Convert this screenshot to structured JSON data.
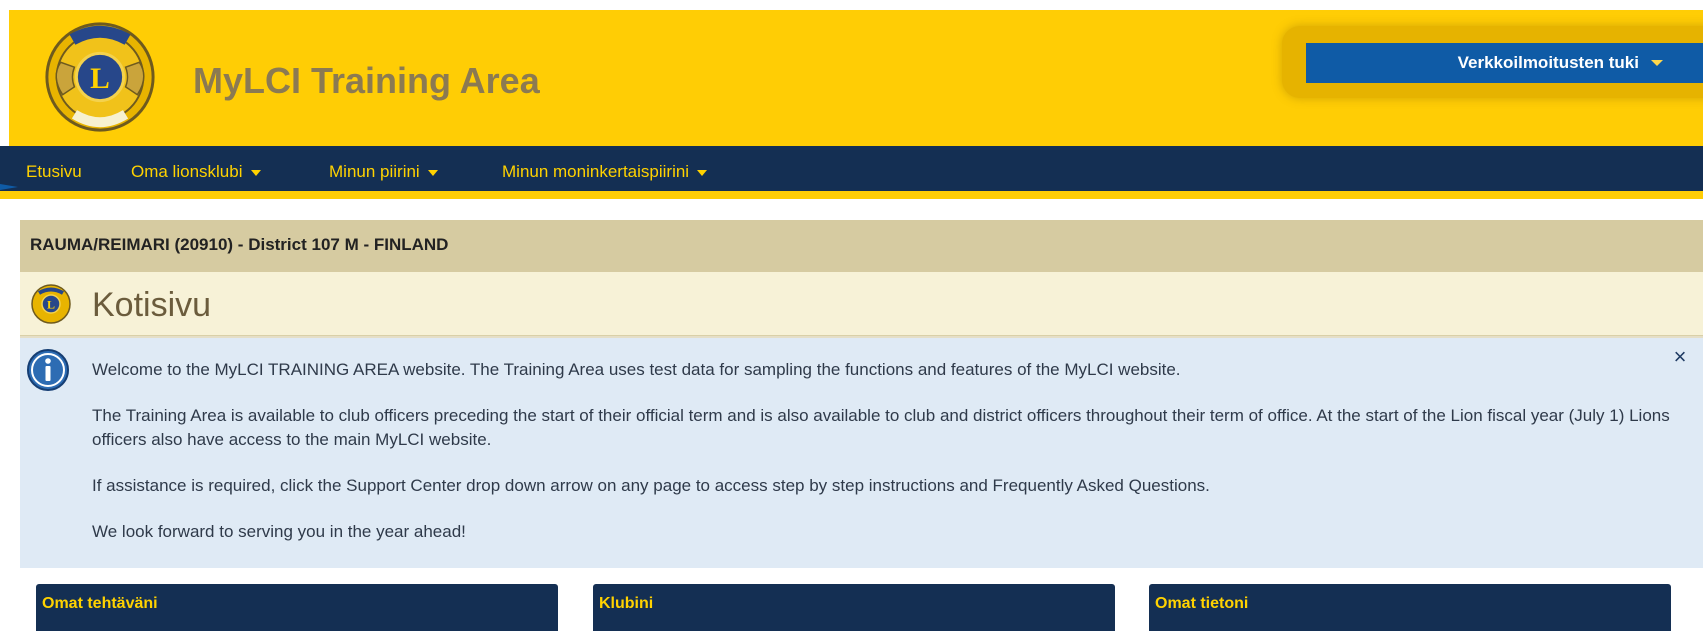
{
  "header": {
    "site_title": "MyLCI Training Area",
    "support_label": "Verkkoilmoitusten tuki",
    "colors": {
      "header_bg": "#ffcd05",
      "nav_bg": "#142f53",
      "nav_text": "#ffd200",
      "support_bg": "#0f5ba6"
    }
  },
  "nav": {
    "home": "Etusivu",
    "club": "Oma lionsklubi",
    "district": "Minun piirini",
    "multi_district": "Minun moninkertaispiirini"
  },
  "club_info": "RAUMA/REIMARI (20910) - District 107 M - FINLAND",
  "page_title": "Kotisivu",
  "info": {
    "p1": "Welcome to the MyLCI TRAINING AREA website. The Training Area uses test data for sampling the functions and features of the MyLCI website.",
    "p2": "The Training Area is available to club officers preceding the start of their official term and is also available to club and district officers throughout their term of office. At the start of the Lion fiscal year (July 1) Lions officers also have access to the main MyLCI website.",
    "p3": "If assistance is required, click the Support Center drop down arrow on any page to access step by step instructions and Frequently Asked Questions.",
    "p4": "We look forward to serving you in the year ahead!",
    "close_symbol": "×"
  },
  "panels": {
    "my_tasks": "Omat tehtäväni",
    "my_club": "Klubini",
    "my_info": "Omat tietoni"
  },
  "icons": [
    "lions-logo-icon",
    "chevron-down-icon",
    "info-icon",
    "close-icon"
  ]
}
